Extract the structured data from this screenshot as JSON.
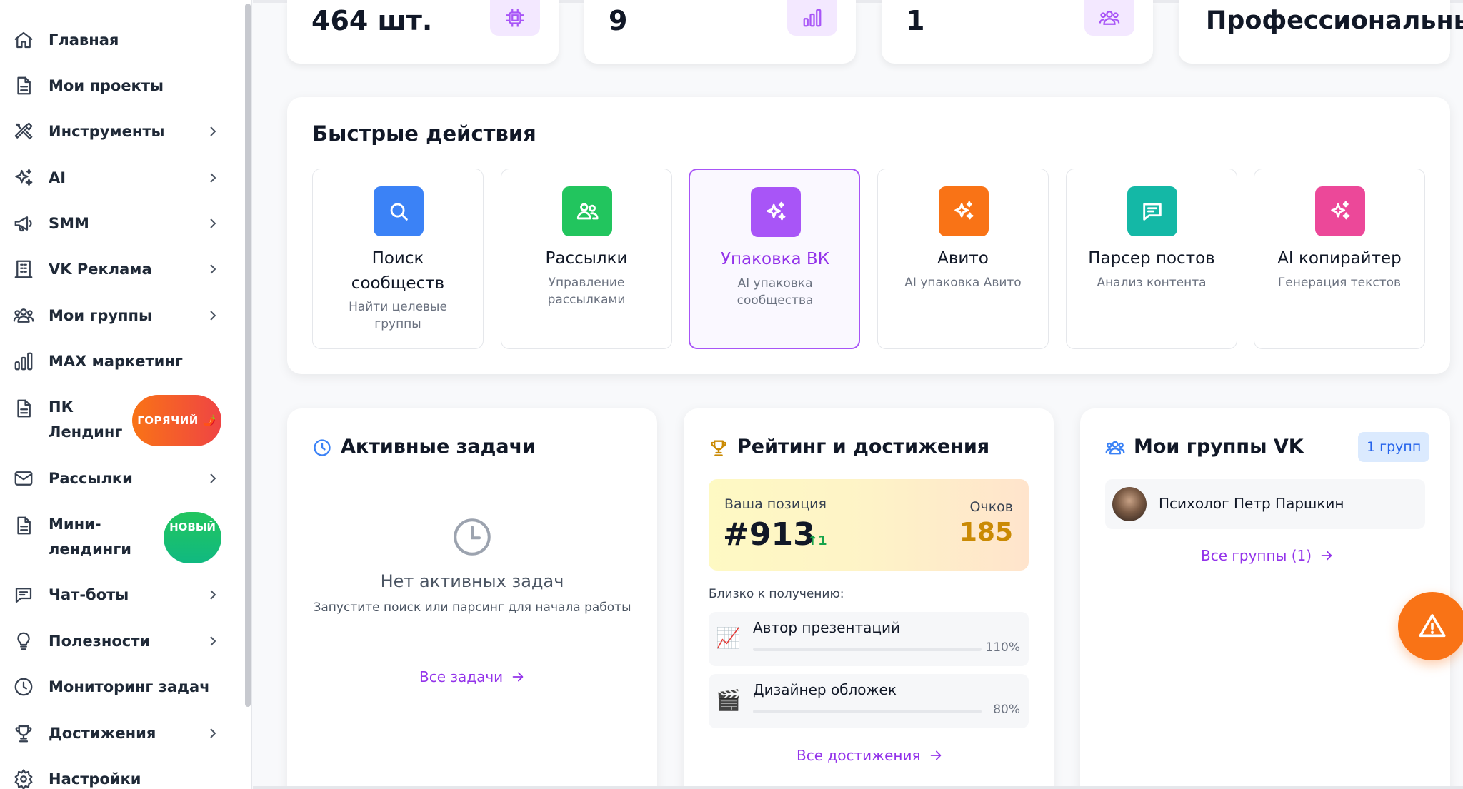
{
  "sidebar": {
    "items": [
      {
        "label": "Главная",
        "icon": "home-icon"
      },
      {
        "label": "Мои проекты",
        "icon": "file-icon"
      },
      {
        "label": "Инструменты",
        "icon": "tools-icon"
      },
      {
        "label": "AI",
        "icon": "sparkles-icon"
      },
      {
        "label": "SMM",
        "icon": "megaphone-icon"
      },
      {
        "label": "VK Реклама",
        "icon": "building-icon"
      },
      {
        "label": "Мои группы",
        "icon": "users-icon"
      },
      {
        "label": "MAX маркетинг",
        "icon": "bar-chart-icon"
      },
      {
        "label": "ПК Лендинг",
        "label_line1": "ПК",
        "label_line2": "Лендинг",
        "icon": "file-icon",
        "badge": "ГОРЯЧИЙ 🌶️"
      },
      {
        "label": "Рассылки",
        "icon": "mail-icon"
      },
      {
        "label": "Мини-лендинги",
        "label_line1": "Мини-",
        "label_line2": "лендинги",
        "icon": "file-icon",
        "badge": "НОВЫЙ"
      },
      {
        "label": "Чат-боты",
        "icon": "chat-icon"
      },
      {
        "label": "Полезности",
        "icon": "lightbulb-icon"
      },
      {
        "label": "Мониторинг задач",
        "icon": "clock-icon"
      },
      {
        "label": "Достижения",
        "icon": "trophy-icon"
      },
      {
        "label": "Настройки",
        "icon": "gear-icon"
      }
    ]
  },
  "stats": [
    {
      "value": "464 шт.",
      "icon": "cpu-icon"
    },
    {
      "value": "9",
      "icon": "bar-chart-icon"
    },
    {
      "value": "1",
      "icon": "users-icon"
    },
    {
      "value": "Профессиональный"
    }
  ],
  "quick_actions": {
    "title": "Быстрые действия",
    "items": [
      {
        "title_line1": "Поиск",
        "title_line2": "сообществ",
        "sub_line1": "Найти целевые",
        "sub_line2": "группы",
        "color": "#3b82f6",
        "icon": "search-icon"
      },
      {
        "title_line1": "Рассылки",
        "sub_line1": "Управление",
        "sub_line2": "рассылками",
        "color": "#22c55e",
        "icon": "users-icon"
      },
      {
        "title_line1": "Упаковка ВК",
        "sub_line1": "AI упаковка",
        "sub_line2": "сообщества",
        "color": "#a855f7",
        "icon": "sparkles-icon"
      },
      {
        "title_line1": "Авито",
        "sub_line1": "AI упаковка Авито",
        "color": "#f97316",
        "icon": "sparkles-icon"
      },
      {
        "title_line1": "Парсер постов",
        "sub_line1": "Анализ контента",
        "color": "#14b8a6",
        "icon": "chat-icon"
      },
      {
        "title_line1": "AI копирайтер",
        "sub_line1": "Генерация текстов",
        "color": "#ec4899",
        "icon": "sparkles-icon"
      }
    ]
  },
  "tasks": {
    "title": "Активные задачи",
    "empty_title": "Нет активных задач",
    "empty_sub": "Запустите поиск или парсинг для начала работы",
    "link": "Все задачи"
  },
  "rating": {
    "title": "Рейтинг и достижения",
    "position_label": "Ваша позиция",
    "position": "#913",
    "change": "↑1",
    "points_label": "Очков",
    "points": "185",
    "near_label": "Близко к получению:",
    "achievements": [
      {
        "emoji": "📈",
        "name": "Автор презентаций",
        "percent": "110%",
        "progress": 1.0
      },
      {
        "emoji": "🎬",
        "name": "Дизайнер обложек",
        "percent": "80%",
        "progress": 0.8
      }
    ],
    "link": "Все достижения"
  },
  "groups": {
    "title": "Мои группы VK",
    "count_badge": "1 групп",
    "items": [
      {
        "name": "Психолог Петр Паршкин"
      }
    ],
    "link": "Все группы (1)"
  },
  "colors": {
    "accent": "#9333ea",
    "fab": "#f97316"
  }
}
